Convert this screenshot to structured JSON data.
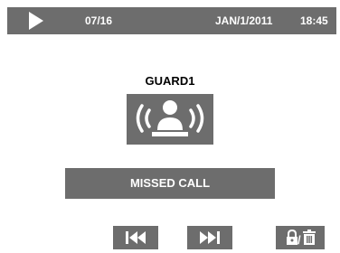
{
  "status_bar": {
    "record_index": "07/16",
    "date": "JAN/1/2011",
    "time": "18:45",
    "play_icon": "play-icon"
  },
  "call": {
    "caller_name": "GUARD1",
    "caller_icon": "guard-station-icon",
    "status_label": "MISSED CALL"
  },
  "controls": {
    "previous_icon": "skip-previous-icon",
    "next_icon": "skip-next-icon",
    "lock_delete_icons": [
      "lock-icon",
      "trash-icon"
    ],
    "separator": "/"
  },
  "colors": {
    "panel_gray": "#6d6d6d",
    "foreground_white": "#ffffff",
    "background": "#ffffff"
  }
}
